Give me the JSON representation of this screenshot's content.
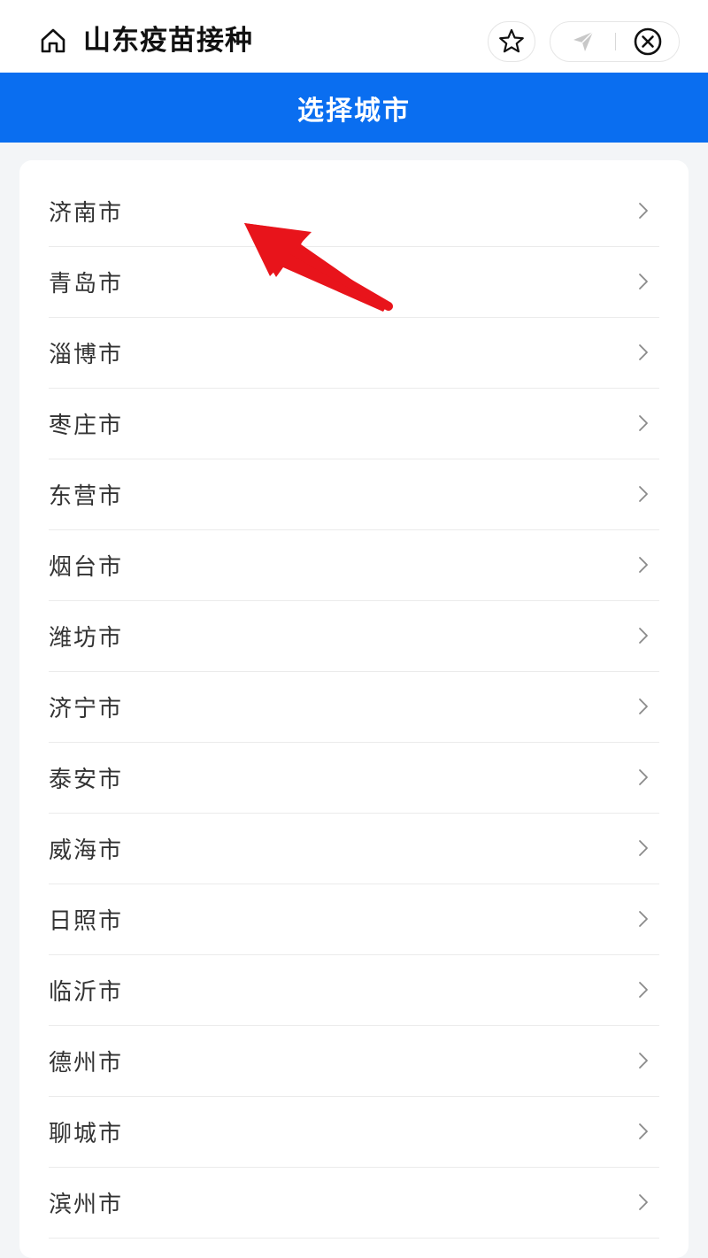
{
  "topbar": {
    "app_title": "山东疫苗接种",
    "icons": [
      "home-icon",
      "star-icon",
      "share-icon",
      "close-icon"
    ]
  },
  "header": {
    "title": "选择城市",
    "background_color": "#0a6ef0"
  },
  "cities": [
    {
      "name": "济南市"
    },
    {
      "name": "青岛市"
    },
    {
      "name": "淄博市"
    },
    {
      "name": "枣庄市"
    },
    {
      "name": "东营市"
    },
    {
      "name": "烟台市"
    },
    {
      "name": "潍坊市"
    },
    {
      "name": "济宁市"
    },
    {
      "name": "泰安市"
    },
    {
      "name": "威海市"
    },
    {
      "name": "日照市"
    },
    {
      "name": "临沂市"
    },
    {
      "name": "德州市"
    },
    {
      "name": "聊城市"
    },
    {
      "name": "滨州市"
    }
  ],
  "annotation": {
    "type": "arrow",
    "color": "#e8141b",
    "points_to": "济南市"
  }
}
